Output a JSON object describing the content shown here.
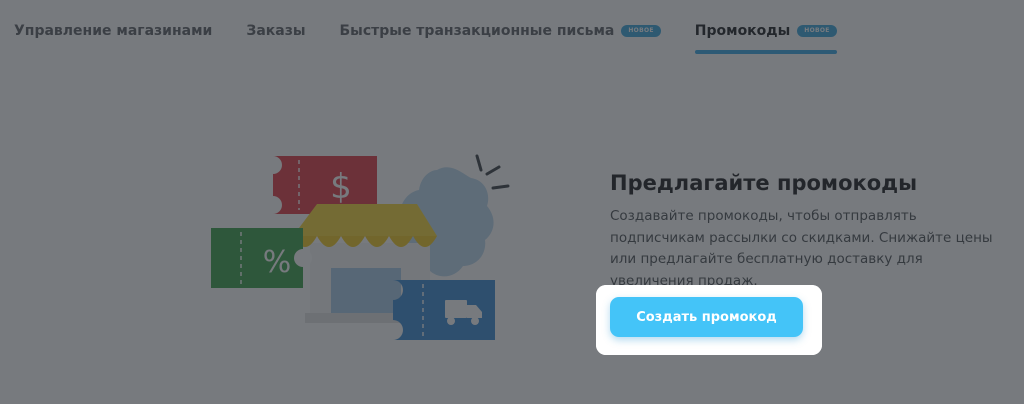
{
  "tabs": [
    {
      "label": "Управление магазинами",
      "badge": ""
    },
    {
      "label": "Заказы",
      "badge": ""
    },
    {
      "label": "Быстрые транзакционные письма",
      "badge": "НОВОЕ"
    },
    {
      "label": "Промокоды",
      "badge": "НОВОЕ"
    }
  ],
  "active_tab": "Промокоды",
  "promo": {
    "title": "Предлагайте промокоды",
    "description": "Создавайте промокоды, чтобы отправлять подписчикам рассылки со скидками. Снижайте цены или предлагайте бесплатную доставку для увеличения продаж.",
    "button_label": "Создать промокод"
  },
  "illustration": {
    "dollar_symbol": "$",
    "percent_symbol": "%",
    "icons": [
      "dollar-coupon",
      "percent-coupon",
      "truck-coupon",
      "shop-awning",
      "badge-shape"
    ]
  },
  "colors": {
    "accent": "#44c4f8",
    "active_underline": "#36a9e6",
    "badge": "#3aa5dc",
    "overlay": "rgba(40,44,50,0.63)"
  }
}
